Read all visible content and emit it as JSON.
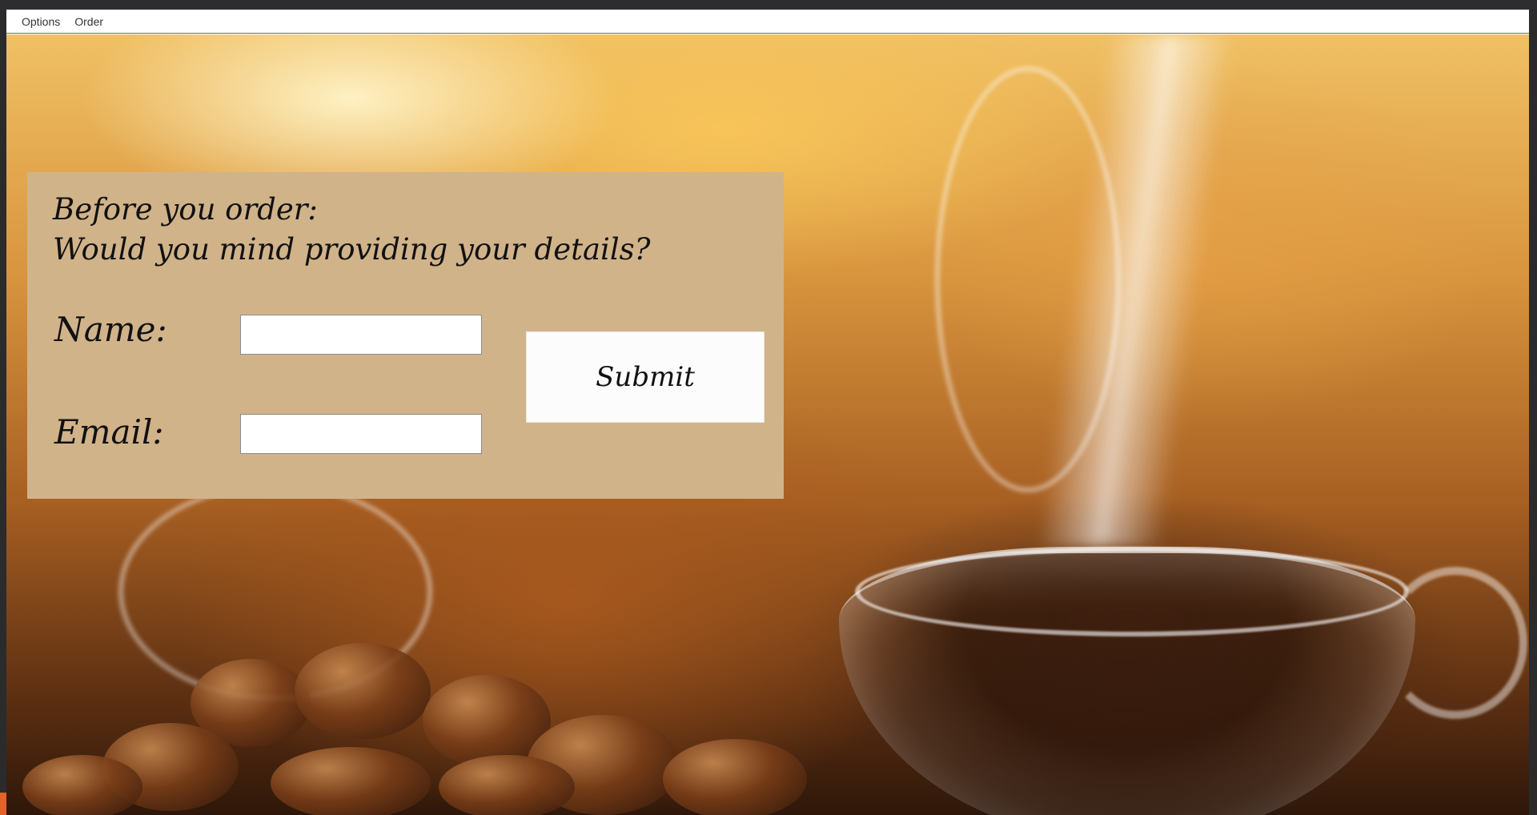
{
  "menubar": {
    "items": [
      {
        "label": "Options"
      },
      {
        "label": "Order"
      }
    ]
  },
  "form": {
    "heading_line1": "Before you order:",
    "heading_line2": "Would you mind providing your details?",
    "name_label": "Name:",
    "name_value": "",
    "email_label": "Email:",
    "email_value": "",
    "submit_label": "Submit"
  },
  "colors": {
    "panel": "#d1b38a",
    "menubar": "#ffffff",
    "button": "#fcfcfc",
    "text": "#111111"
  }
}
